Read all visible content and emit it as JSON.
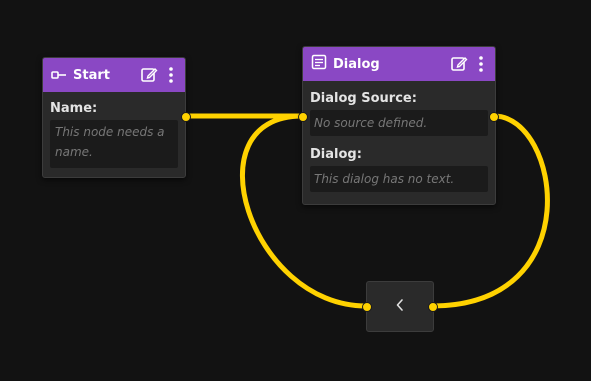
{
  "start_node": {
    "title": "Start",
    "name_label": "Name:",
    "name_placeholder": "This node needs a name."
  },
  "dialog_node": {
    "title": "Dialog",
    "source_label": "Dialog Source:",
    "source_placeholder": "No source defined.",
    "dialog_label": "Dialog:",
    "dialog_placeholder": "This dialog has no text."
  },
  "colors": {
    "canvas": "#121212",
    "header": "#8a48c4",
    "edge": "#ffd200",
    "node_body": "#2a2a2a"
  },
  "icons": {
    "start": "start-key-icon",
    "dialog": "dialog-doc-icon",
    "edit": "edit-icon",
    "menu": "more-vertical-icon",
    "back": "chevron-left-icon"
  }
}
